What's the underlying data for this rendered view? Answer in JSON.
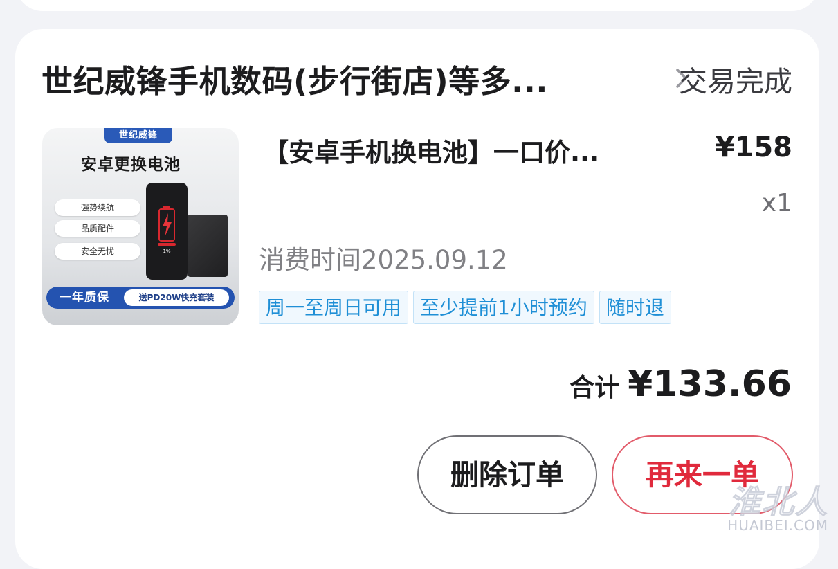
{
  "order": {
    "store_name": "世纪威锋手机数码(步行街店)等多...",
    "status": "交易完成",
    "product": {
      "title": "【安卓手机换电池】一口价...",
      "price": "¥158",
      "quantity": "x1",
      "consume_time": "消费时间2025.09.12",
      "tags": [
        "周一至周日可用",
        "至少提前1小时预约",
        "随时退"
      ],
      "thumbnail": {
        "brand": "世纪威锋",
        "title": "安卓更换电池",
        "features": [
          "强势续航",
          "品质配件",
          "安全无忧"
        ],
        "battery_level": "1%",
        "banner_left": "一年质保",
        "banner_right": "送PD20W快充套装"
      }
    },
    "total_label": "合计",
    "total_value": "¥133.66",
    "buttons": {
      "delete": "删除订单",
      "reorder": "再来一单"
    }
  },
  "watermark": {
    "cn": "淮北人",
    "en": "HUAIBEI.COM"
  },
  "colors": {
    "background": "#f2f3f7",
    "card": "#ffffff",
    "tag_text": "#1f8fd6",
    "reorder_accent": "#e02a3c",
    "thumbnail_banner": "#2453b0"
  },
  "icons": {
    "store_chevron": "chevron-right-icon",
    "thumbnail_brand": "shield-logo-icon"
  }
}
